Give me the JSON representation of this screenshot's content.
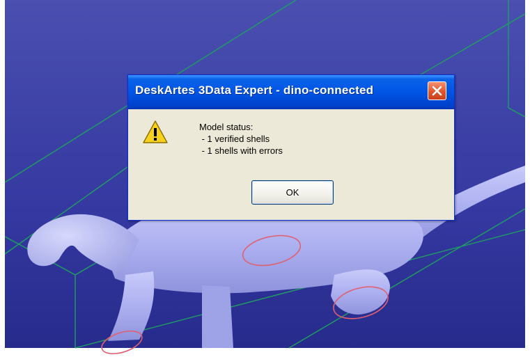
{
  "scene": {
    "background_color": "#34389c",
    "model_color": "#b4b8f5",
    "wireframe_color": "#1f9e5a",
    "error_marker_color": "#e06070",
    "frame_color": "#ffffff"
  },
  "dialog": {
    "title": "DeskArtes 3Data Expert - dino-connected",
    "icon": "warning-icon",
    "close_icon": "close-icon",
    "message": {
      "heading": "Model status:",
      "lines": [
        " - 1 verified shells",
        " - 1 shells with errors"
      ]
    },
    "ok_label": "OK",
    "colors": {
      "titlebar": "#0055e5",
      "body": "#ece9d8",
      "close_button": "#e0562c"
    }
  }
}
